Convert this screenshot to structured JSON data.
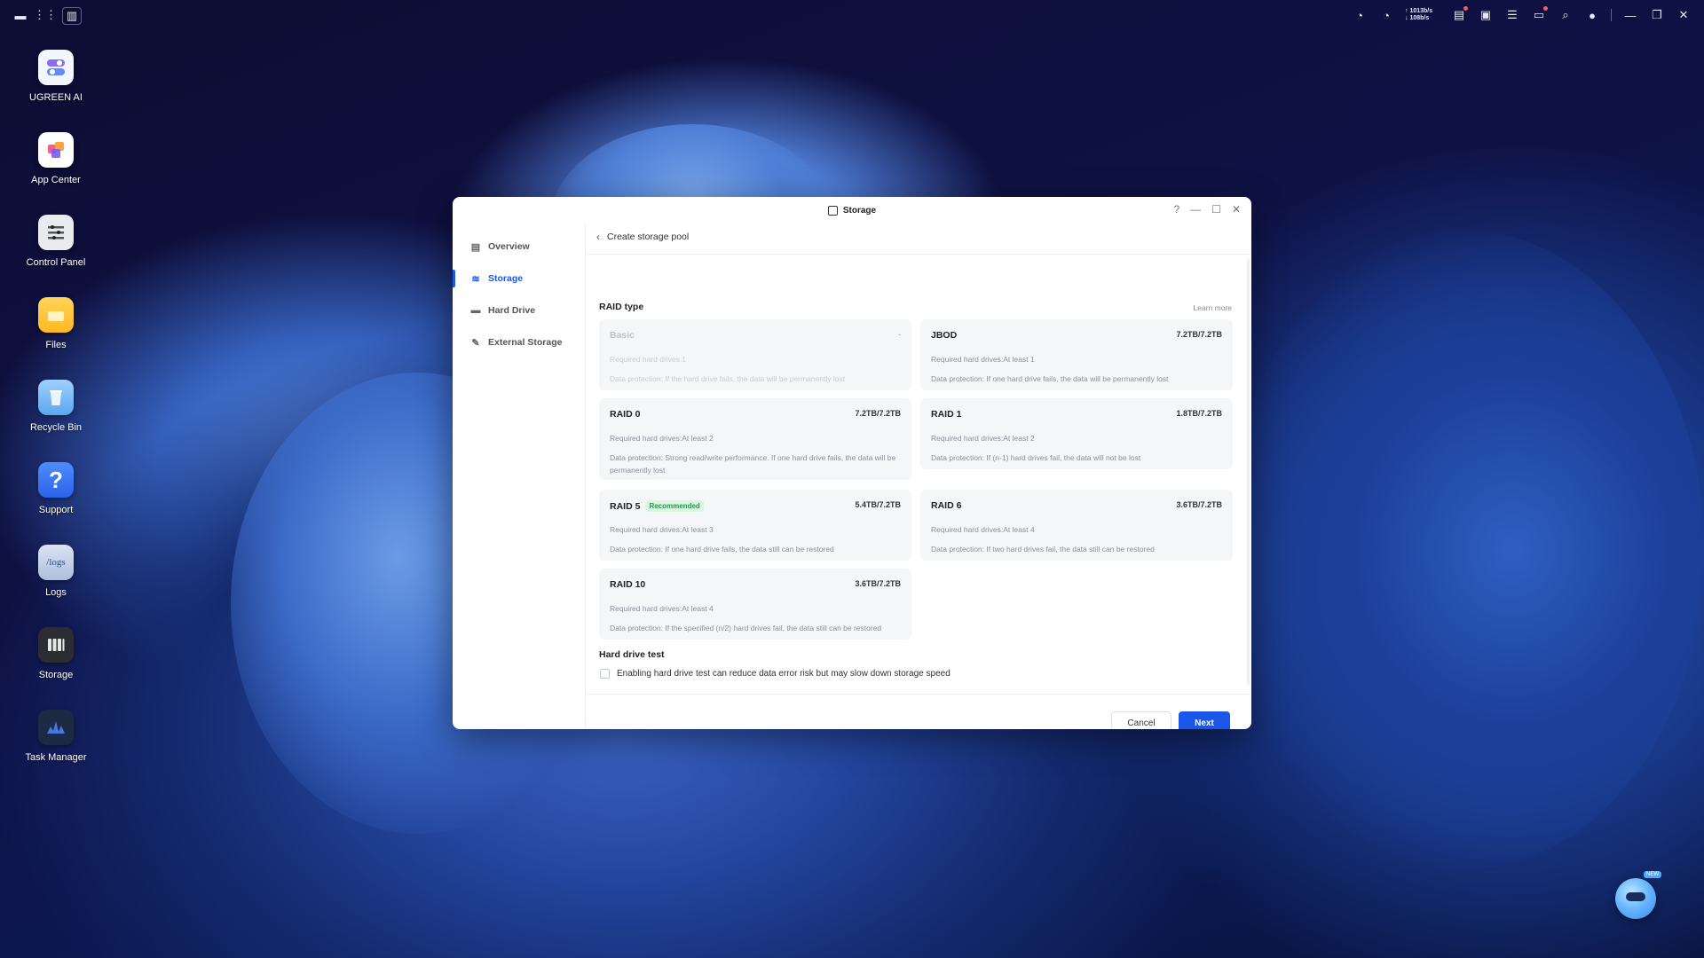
{
  "desktop": {
    "apps": [
      {
        "label": "UGREEN AI",
        "icon": "ugreen-ai-icon"
      },
      {
        "label": "App Center",
        "icon": "app-center-icon"
      },
      {
        "label": "Control Panel",
        "icon": "control-panel-icon"
      },
      {
        "label": "Files",
        "icon": "files-icon"
      },
      {
        "label": "Recycle Bin",
        "icon": "recycle-bin-icon"
      },
      {
        "label": "Support",
        "icon": "support-icon"
      },
      {
        "label": "Logs",
        "icon": "logs-icon"
      },
      {
        "label": "Storage",
        "icon": "storage-icon"
      },
      {
        "label": "Task Manager",
        "icon": "task-manager-icon"
      }
    ],
    "logs_icon_text": "/logs",
    "support_icon_text": "?"
  },
  "topbar": {
    "net_up": "↑ 1013b/s",
    "net_down": "↓ 108b/s"
  },
  "window": {
    "title": "Storage",
    "sidebar": [
      {
        "label": "Overview",
        "icon": "overview-icon"
      },
      {
        "label": "Storage",
        "icon": "storage-stack-icon",
        "active": true
      },
      {
        "label": "Hard Drive",
        "icon": "hard-drive-icon"
      },
      {
        "label": "External Storage",
        "icon": "external-storage-icon"
      }
    ],
    "breadcrumb": "Create storage pool",
    "raid_section": {
      "title": "RAID type",
      "learn_more": "Learn more",
      "options": [
        {
          "name": "Basic",
          "capacity": "-",
          "required": "Required hard drives:1",
          "protection": "Data protection:  If the hard drive fails, the data will be permanently lost",
          "disabled": true
        },
        {
          "name": "JBOD",
          "capacity": "7.2TB/7.2TB",
          "required": "Required hard drives:At least 1",
          "protection": "Data protection:  If one hard drive fails, the data will be permanently lost"
        },
        {
          "name": "RAID 0",
          "capacity": "7.2TB/7.2TB",
          "required": "Required hard drives:At least 2",
          "protection": "Data protection:  Strong read/write performance. If one hard drive fails, the data will be permanently lost"
        },
        {
          "name": "RAID 1",
          "capacity": "1.8TB/7.2TB",
          "required": "Required hard drives:At least 2",
          "protection": "Data protection:  If (n-1) hard drives fail, the data will not be lost"
        },
        {
          "name": "RAID 5",
          "badge": "Recommended",
          "capacity": "5.4TB/7.2TB",
          "required": "Required hard drives:At least 3",
          "protection": "Data protection:  If one hard drive fails, the data still can be restored"
        },
        {
          "name": "RAID 6",
          "capacity": "3.6TB/7.2TB",
          "required": "Required hard drives:At least 4",
          "protection": "Data protection:  If two hard drives fail, the data still can be restored"
        },
        {
          "name": "RAID 10",
          "capacity": "3.6TB/7.2TB",
          "required": "Required hard drives:At least 4",
          "protection": "Data protection:  If the specified (n/2) hard drives fail, the data still can be restored"
        }
      ]
    },
    "hdd_test": {
      "title": "Hard drive test",
      "checkbox_label": "Enabling hard drive test can reduce data error risk but may slow down storage speed",
      "checked": false
    },
    "buttons": {
      "cancel": "Cancel",
      "next": "Next"
    }
  },
  "assistant": {
    "tag": "NEW"
  },
  "colors": {
    "accent": "#1a57e8",
    "badge_green": "#1f9b4a"
  }
}
